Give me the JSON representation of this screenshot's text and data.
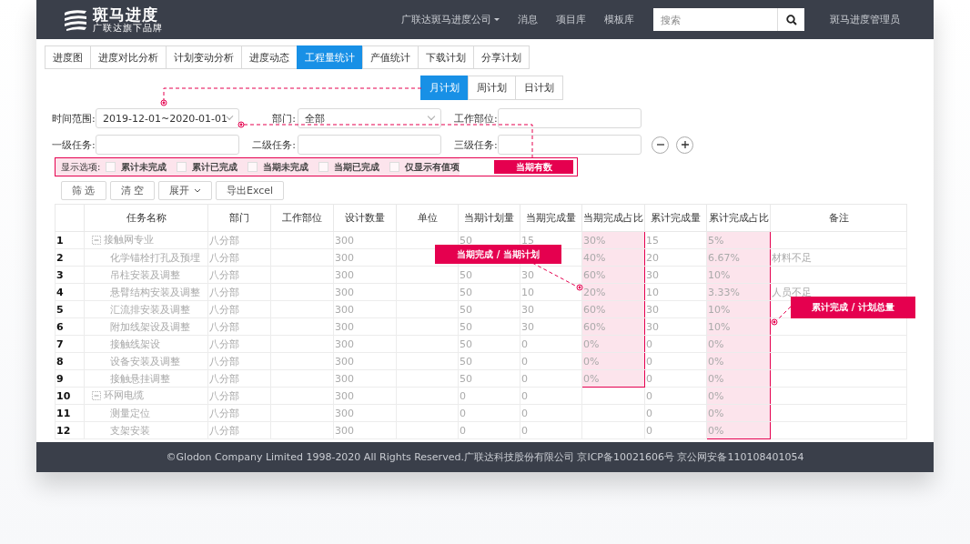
{
  "header": {
    "logo": {
      "title": "斑马进度",
      "tagline": "广联达旗下品牌"
    },
    "nav": [
      {
        "label": "广联达斑马进度公司",
        "kind": "dropdown"
      },
      {
        "label": "消息",
        "kind": "link"
      },
      {
        "label": "项目库",
        "kind": "link"
      },
      {
        "label": "模板库",
        "kind": "link"
      }
    ],
    "search": {
      "placeholder": "搜索"
    },
    "user": "斑马进度管理员"
  },
  "tabs": [
    {
      "label": "进度图",
      "selected": false
    },
    {
      "label": "进度对比分析",
      "selected": false
    },
    {
      "label": "计划变动分析",
      "selected": false
    },
    {
      "label": "进度动态",
      "selected": false
    },
    {
      "label": "工程量统计",
      "selected": true
    },
    {
      "label": "产值统计",
      "selected": false
    },
    {
      "label": "下载计划",
      "selected": false
    },
    {
      "label": "分享计划",
      "selected": false
    }
  ],
  "plan_tabs": [
    {
      "label": "月计划",
      "selected": true
    },
    {
      "label": "周计划",
      "selected": false
    },
    {
      "label": "日计划",
      "selected": false
    }
  ],
  "filters": {
    "time_range": {
      "label": "时间范围:",
      "value": "2019-12-01~2020-01-01"
    },
    "department": {
      "label": "部门:",
      "value": "全部"
    },
    "work_site": {
      "label": "工作部位:"
    },
    "task_levels": [
      {
        "label": "一级任务:"
      },
      {
        "label": "二级任务:"
      },
      {
        "label": "三级任务:"
      }
    ]
  },
  "display_options": {
    "label": "显示选项:",
    "options": [
      {
        "label": "累计未完成",
        "checked": false
      },
      {
        "label": "累计已完成",
        "checked": false
      },
      {
        "label": "当期未完成",
        "checked": false
      },
      {
        "label": "当期已完成",
        "checked": false
      },
      {
        "label": "仅显示有值项",
        "checked": false
      }
    ]
  },
  "buttons": [
    {
      "label": "筛 选",
      "kind": "plain"
    },
    {
      "label": "清 空",
      "kind": "plain"
    },
    {
      "label": "展开",
      "kind": "dropdown"
    },
    {
      "label": "导出Excel",
      "kind": "plain"
    }
  ],
  "table": {
    "columns": [
      "任务名称",
      "部门",
      "工作部位",
      "设计数量",
      "单位",
      "当期计划量",
      "当期完成量",
      "当期完成占比",
      "累计完成量",
      "累计完成占比",
      "备注"
    ],
    "rows": [
      {
        "no": "1",
        "task": "接触网专业",
        "expanded": true,
        "dept": "八分部",
        "design_qty": "300",
        "plan_qty": "50",
        "done_qty": "15",
        "done_ratio": "30%",
        "total_done": "15",
        "total_ratio": "5%",
        "done_ratio_marked": true,
        "total_ratio_marked": true,
        "children": [
          {
            "no": "2",
            "task": "化学锚栓打孔及预埋",
            "dept": "八分部",
            "design_qty": "300",
            "done_ratio": "40%",
            "total_done": "20",
            "total_ratio": "6.67%",
            "remark": "材料不足",
            "done_ratio_marked": true,
            "total_ratio_marked": true
          },
          {
            "no": "3",
            "task": "吊柱安装及调整",
            "dept": "八分部",
            "design_qty": "300",
            "plan_qty": "50",
            "done_qty": "30",
            "done_ratio": "60%",
            "total_done": "30",
            "total_ratio": "10%",
            "done_ratio_marked": true,
            "total_ratio_marked": true
          },
          {
            "no": "4",
            "task": "悬臂结构安装及调整",
            "dept": "八分部",
            "design_qty": "300",
            "plan_qty": "50",
            "done_qty": "10",
            "done_ratio": "20%",
            "total_done": "10",
            "total_ratio": "3.33%",
            "remark": "人员不足",
            "done_ratio_marked": true,
            "total_ratio_marked": true
          },
          {
            "no": "5",
            "task": "汇流排安装及调整",
            "dept": "八分部",
            "design_qty": "300",
            "plan_qty": "50",
            "done_qty": "30",
            "done_ratio": "60%",
            "total_done": "30",
            "total_ratio": "10%",
            "done_ratio_marked": true,
            "total_ratio_marked": true
          },
          {
            "no": "6",
            "task": "附加线架设及调整",
            "dept": "八分部",
            "design_qty": "300",
            "plan_qty": "50",
            "done_qty": "30",
            "done_ratio": "60%",
            "total_done": "30",
            "total_ratio": "10%",
            "done_ratio_marked": true,
            "total_ratio_marked": true
          },
          {
            "no": "7",
            "task": "接触线架设",
            "dept": "八分部",
            "design_qty": "300",
            "plan_qty": "50",
            "done_qty": "0",
            "done_ratio": "0%",
            "total_done": "0",
            "total_ratio": "0%",
            "done_ratio_marked": true,
            "total_ratio_marked": true
          },
          {
            "no": "8",
            "task": "设备安装及调整",
            "dept": "八分部",
            "design_qty": "300",
            "plan_qty": "50",
            "done_qty": "0",
            "done_ratio": "0%",
            "total_done": "0",
            "total_ratio": "0%",
            "done_ratio_marked": true,
            "total_ratio_marked": true
          },
          {
            "no": "9",
            "task": "接触悬挂调整",
            "dept": "八分部",
            "design_qty": "300",
            "plan_qty": "50",
            "done_qty": "0",
            "done_ratio": "0%",
            "total_done": "0",
            "total_ratio": "0%",
            "done_ratio_marked": true,
            "total_ratio_marked": true
          }
        ]
      },
      {
        "no": "10",
        "task": "环网电缆",
        "expanded": true,
        "dept": "八分部",
        "design_qty": "300",
        "plan_qty": "0",
        "done_qty": "0",
        "total_done": "0",
        "total_ratio": "0%",
        "done_ratio_marked": false,
        "total_ratio_marked": true,
        "children": [
          {
            "no": "11",
            "task": "测量定位",
            "dept": "八分部",
            "design_qty": "300",
            "plan_qty": "0",
            "done_qty": "0",
            "total_done": "0",
            "total_ratio": "0%",
            "done_ratio_marked": false,
            "total_ratio_marked": true
          },
          {
            "no": "12",
            "task": "支架安装",
            "dept": "八分部",
            "design_qty": "300",
            "plan_qty": "0",
            "done_qty": "0",
            "total_done": "0",
            "total_ratio": "0%",
            "done_ratio_marked": false,
            "total_ratio_marked": true
          }
        ]
      }
    ]
  },
  "callouts": [
    {
      "label": "当期有数",
      "kind": "options"
    },
    {
      "label": "当期完成 / 当期计划",
      "kind": "current"
    },
    {
      "label": "累计完成 / 计划总量",
      "kind": "total"
    }
  ],
  "footer": "©Glodon Company Limited 1998-2020 All Rights Reserved.广联达科技股份有限公司 京ICP备10021606号 京公网安备110108401054"
}
